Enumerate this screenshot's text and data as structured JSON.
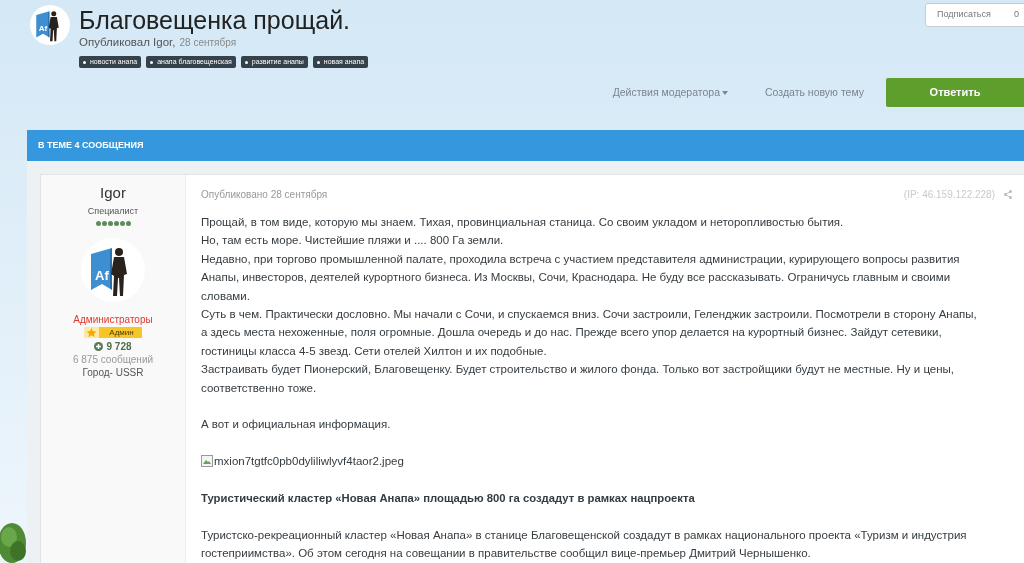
{
  "topic": {
    "avatar_text": "Af",
    "title": "Благовещенка прощай.",
    "byline": "Опубликовал Igor,",
    "date": "28 сентября",
    "tags": [
      "новости анапа",
      "анапа благовещенская",
      "развитие анапы",
      "новая анапа"
    ]
  },
  "subscribe": {
    "label": "Подписаться",
    "count": "0"
  },
  "actions": {
    "moderator": "Действия модератора",
    "new_topic": "Создать новую тему",
    "reply": "Ответить"
  },
  "bar": {
    "title": "В ТЕМЕ 4 СООБЩЕНИЯ"
  },
  "post": {
    "author": {
      "name": "Igor",
      "rank": "Специалист",
      "stars": 6,
      "avatar_text": "Af",
      "group": "Администраторы",
      "badge": "Админ",
      "reputation": "9 728",
      "posts": "6 875 сообщений",
      "city": "Город- USSR"
    },
    "published": "Опубликовано 28 сентября",
    "ip": "(IP: 46.159.122.228)",
    "body": [
      {
        "kind": "line",
        "text": "Прощай, в том виде, которую мы знаем. Тихая, провинциальная станица. Со своим укладом и неторопливостью бытия."
      },
      {
        "kind": "line",
        "text": "Но, там есть море. Чистейшие пляжи и .... 800 Га земли."
      },
      {
        "kind": "line",
        "text": "Недавно, при торгово промышленной палате, проходила встреча с участием представителя администрации, курирующего вопросы развития Анапы, инвесторов, деятелей курортного бизнеса. Из Москвы, Сочи, Краснодара. Не буду все рассказывать. Ограничусь главным и своими словами."
      },
      {
        "kind": "line",
        "text": "Суть в чем. Практически дословно. Мы начали с Сочи, и спускаемся вниз. Сочи застроили, Геленджик застроили. Посмотрели в сторону Анапы, а здесь места нехоженные, поля огромные. Дошла очередь и до нас. Прежде всего упор делается на курортный бизнес. Зайдут сетевики, гостиницы класса 4-5 звезд. Сети отелей Хилтон и их подобные."
      },
      {
        "kind": "line",
        "text": "Застраивать будет Пионерский, Благовещенку. Будет строительство и жилого фонда. Только вот застройщики будут не местные. Ну и цены, соответственно тоже."
      },
      {
        "kind": "gap"
      },
      {
        "kind": "line",
        "text": "А вот и официальная информация."
      },
      {
        "kind": "gap"
      },
      {
        "kind": "image",
        "text": "mxion7tgtfc0pb0dyliliwlyvf4taor2.jpeg"
      },
      {
        "kind": "gap"
      },
      {
        "kind": "heading",
        "text": "Туристический кластер «Новая Анапа» площадью 800 га создадут в рамках нацпроекта"
      },
      {
        "kind": "gap"
      },
      {
        "kind": "line",
        "text": "Туристско-рекреационный кластер «Новая Анапа» в станице Благовещенской создадут в рамках национального проекта «Туризм и индустрия гостеприимства». Об этом сегодня на совещании в правительстве сообщил вице-премьер Дмитрий Чернышенко."
      }
    ]
  }
}
